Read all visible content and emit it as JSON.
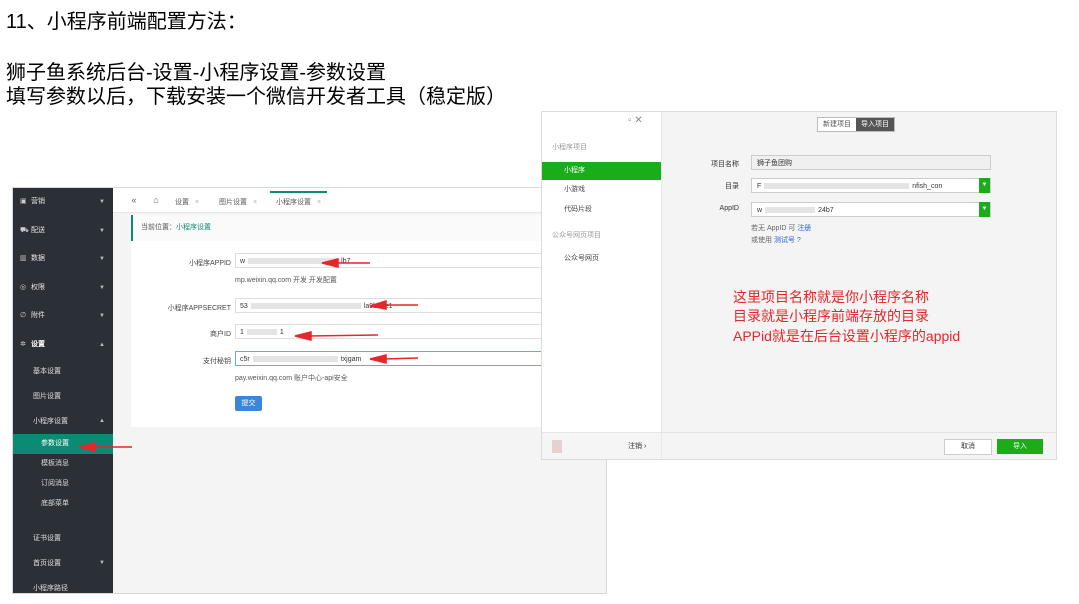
{
  "doc": {
    "heading": "11、小程序前端配置方法：",
    "line1": "狮子鱼系统后台-设置-小程序设置-参数设置",
    "line2": "填写参数以后，下载安装一个微信开发者工具（稳定版）"
  },
  "admin": {
    "sidebar": {
      "items": [
        {
          "label": "营销",
          "icon": "cart-icon"
        },
        {
          "label": "配送",
          "icon": "truck-icon"
        },
        {
          "label": "数据",
          "icon": "chart-icon"
        },
        {
          "label": "权限",
          "icon": "lock-icon"
        },
        {
          "label": "附件",
          "icon": "paperclip-icon"
        },
        {
          "label": "设置",
          "icon": "gear-icon"
        }
      ],
      "settings_sub": [
        "基本设置",
        "图片设置",
        "小程序设置"
      ],
      "mp_sub": [
        "参数设置",
        "模板消息",
        "订阅消息",
        "底部菜单"
      ],
      "more_sub": [
        "证书设置",
        "首页设置",
        "小程序路径"
      ]
    },
    "tabs": [
      "设置",
      "图片设置",
      "小程序设置"
    ],
    "breadcrumb": {
      "prefix": "当前位置：",
      "current": "小程序设置"
    },
    "form": {
      "appid_label": "小程序APPID",
      "appid_value_start": "w",
      "appid_value_end": "lb7",
      "appid_help": "mp.weixin.qq.com 开发 开发配置",
      "secret_label": "小程序APPSECRET",
      "secret_value_start": "53",
      "secret_value_end": "la9bb8e1",
      "merchant_label": "商户ID",
      "merchant_value_start": "1",
      "merchant_value_end": "1",
      "paykey_label": "支付秘钥",
      "paykey_value_start": "c5r",
      "paykey_value_end": "txjgam",
      "pay_help": "pay.weixin.qq.com 账户中心-api安全",
      "submit_label": "提交"
    }
  },
  "devtools": {
    "section_mini": "小程序项目",
    "items_mini": [
      "小程序",
      "小游戏",
      "代码片段"
    ],
    "section_oa": "公众号网页项目",
    "items_oa": [
      "公众号网页"
    ],
    "logout": "注销 ›",
    "toggle": [
      "新建项目",
      "导入项目"
    ],
    "project_name_label": "项目名称",
    "project_name_value": "狮子鱼团购",
    "dir_label": "目录",
    "dir_value_start": "F",
    "dir_value_end": "nfish_con",
    "appid_label": "AppID",
    "appid_value_start": "w",
    "appid_value_end": "24b7",
    "note1_prefix": "若无 AppID 可",
    "note1_link": "注册",
    "note2_prefix": "或使用",
    "note2_link": "测试号",
    "note2_q": "?",
    "cancel": "取消",
    "import": "导入"
  },
  "annotation": {
    "line1": "这里项目名称就是你小程序名称",
    "line2": "目录就是小程序前端存放的目录",
    "line3": "APPid就是在后台设置小程序的appid"
  },
  "colors": {
    "annotation_red": "#e5262a",
    "admin_accent": "#0c8a73",
    "wechat_green": "#1aad19",
    "sidebar_bg": "#2b2f36"
  }
}
